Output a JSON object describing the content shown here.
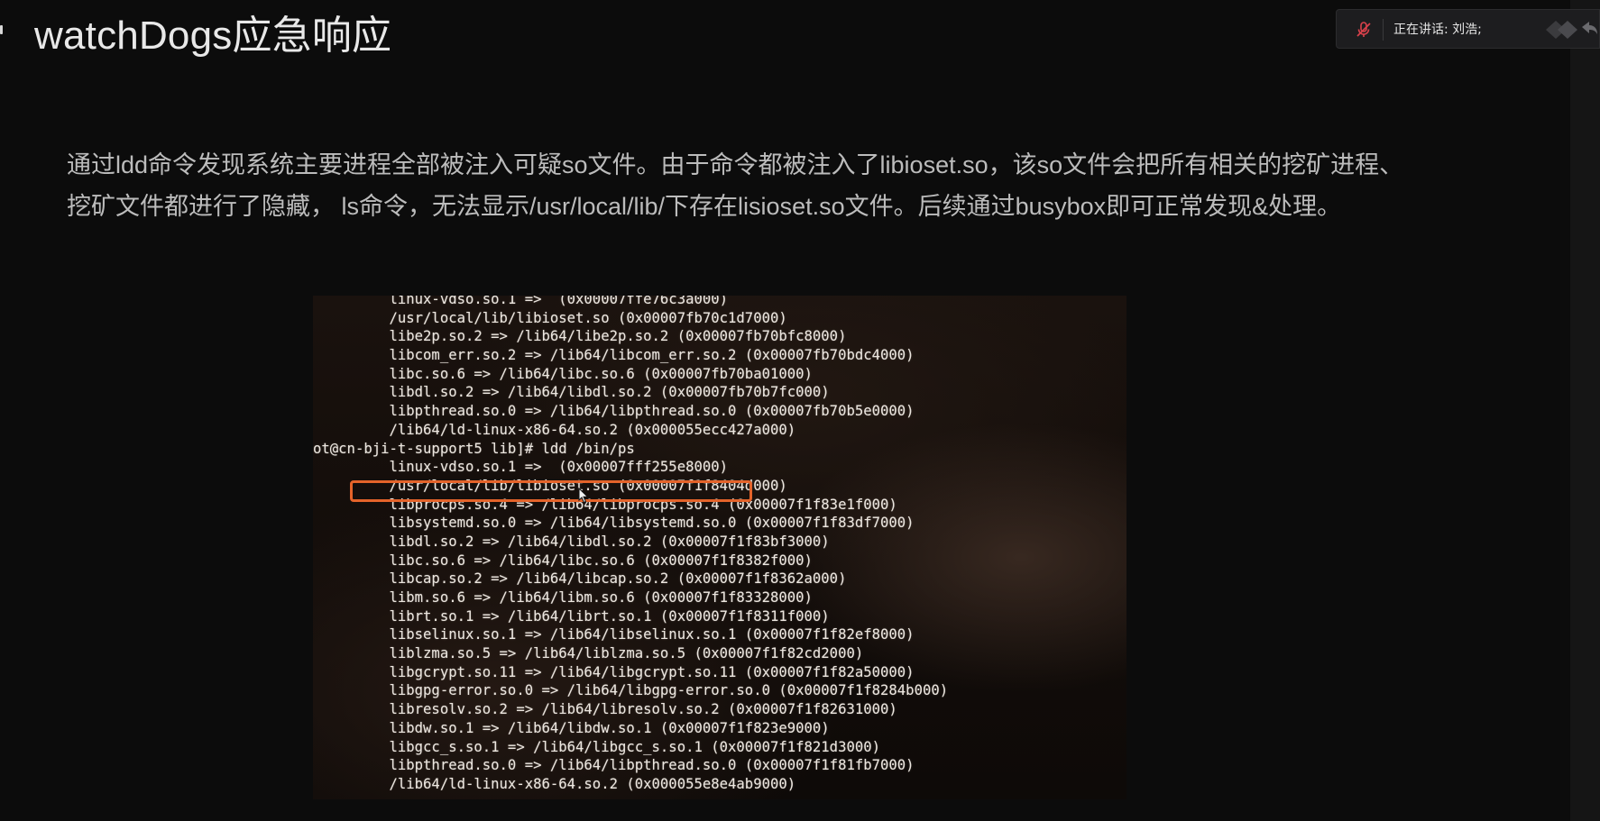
{
  "page": {
    "title": "watchDogs应急响应",
    "paragraph_lines": [
      "通过ldd命令发现系统主要进程全部被注入可疑so文件。由于命令都被注入了libioset.so，该so文件会把所有相关的挖矿进程、",
      "挖矿文件都进行了隐藏， ls命令，无法显示/usr/local/lib/下存在lisioset.so文件。后续通过busybox即可正常发现&处理。"
    ]
  },
  "meeting": {
    "speaking_label": "正在讲话: 刘浩;",
    "mic_icon": "mic-muted-icon"
  },
  "terminal": {
    "lines": [
      "         linux-vdso.so.1 =>  (0x00007ffe76c3a000)",
      "         /usr/local/lib/libioset.so (0x00007fb70c1d7000)",
      "         libe2p.so.2 => /lib64/libe2p.so.2 (0x00007fb70bfc8000)",
      "         libcom_err.so.2 => /lib64/libcom_err.so.2 (0x00007fb70bdc4000)",
      "         libc.so.6 => /lib64/libc.so.6 (0x00007fb70ba01000)",
      "         libdl.so.2 => /lib64/libdl.so.2 (0x00007fb70b7fc000)",
      "         libpthread.so.0 => /lib64/libpthread.so.0 (0x00007fb70b5e0000)",
      "         /lib64/ld-linux-x86-64.so.2 (0x000055ecc427a000)",
      "ot@cn-bji-t-support5 lib]# ldd /bin/ps",
      "         linux-vdso.so.1 =>  (0x00007fff255e8000)",
      "         /usr/local/lib/libioset.so (0x00007f1f8404d000)",
      "         libprocps.so.4 => /lib64/libprocps.so.4 (0x00007f1f83e1f000)",
      "         libsystemd.so.0 => /lib64/libsystemd.so.0 (0x00007f1f83df7000)",
      "         libdl.so.2 => /lib64/libdl.so.2 (0x00007f1f83bf3000)",
      "         libc.so.6 => /lib64/libc.so.6 (0x00007f1f8382f000)",
      "         libcap.so.2 => /lib64/libcap.so.2 (0x00007f1f8362a000)",
      "         libm.so.6 => /lib64/libm.so.6 (0x00007f1f83328000)",
      "         librt.so.1 => /lib64/librt.so.1 (0x00007f1f8311f000)",
      "         libselinux.so.1 => /lib64/libselinux.so.1 (0x00007f1f82ef8000)",
      "         liblzma.so.5 => /lib64/liblzma.so.5 (0x00007f1f82cd2000)",
      "         libgcrypt.so.11 => /lib64/libgcrypt.so.11 (0x00007f1f82a50000)",
      "         libgpg-error.so.0 => /lib64/libgpg-error.so.0 (0x00007f1f8284b000)",
      "         libresolv.so.2 => /lib64/libresolv.so.2 (0x00007f1f82631000)",
      "         libdw.so.1 => /lib64/libdw.so.1 (0x00007f1f823e9000)",
      "         libgcc_s.so.1 => /lib64/libgcc_s.so.1 (0x00007f1f821d3000)",
      "         libpthread.so.0 => /lib64/libpthread.so.0 (0x00007f1f81fb7000)",
      "         /lib64/ld-linux-x86-64.so.2 (0x000055e8e4ab9000)"
    ]
  },
  "colors": {
    "background": "#0c0c0c",
    "title": "#e8e8e8",
    "body_text": "#bcbcbc",
    "highlight": "#e4632a",
    "mic_muted": "#d9414b"
  }
}
